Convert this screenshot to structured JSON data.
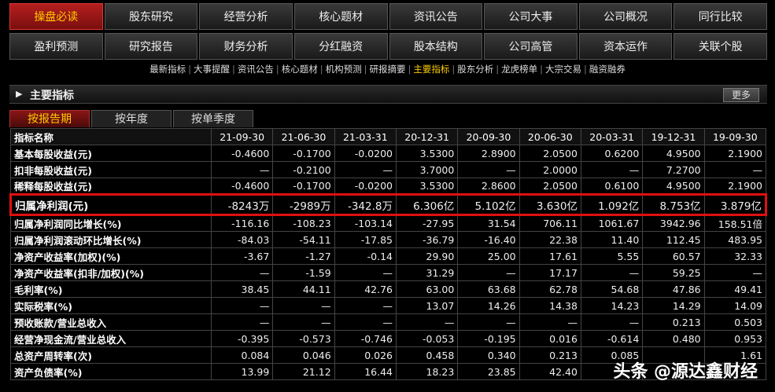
{
  "nav_rows": [
    [
      {
        "label": "操盘必读",
        "active": true
      },
      {
        "label": "股东研究",
        "active": false
      },
      {
        "label": "经营分析",
        "active": false
      },
      {
        "label": "核心题材",
        "active": false
      },
      {
        "label": "资讯公告",
        "active": false
      },
      {
        "label": "公司大事",
        "active": false
      },
      {
        "label": "公司概况",
        "active": false
      },
      {
        "label": "同行比较",
        "active": false
      }
    ],
    [
      {
        "label": "盈利预测",
        "active": false
      },
      {
        "label": "研究报告",
        "active": false
      },
      {
        "label": "财务分析",
        "active": false
      },
      {
        "label": "分红融资",
        "active": false
      },
      {
        "label": "股本结构",
        "active": false
      },
      {
        "label": "公司高管",
        "active": false
      },
      {
        "label": "资本运作",
        "active": false
      },
      {
        "label": "关联个股",
        "active": false
      }
    ]
  ],
  "subnav": [
    {
      "label": "最新指标",
      "active": false
    },
    {
      "label": "大事提醒",
      "active": false
    },
    {
      "label": "资讯公告",
      "active": false
    },
    {
      "label": "核心题材",
      "active": false
    },
    {
      "label": "机构预测",
      "active": false
    },
    {
      "label": "研报摘要",
      "active": false
    },
    {
      "label": "主要指标",
      "active": true
    },
    {
      "label": "股东分析",
      "active": false
    },
    {
      "label": "龙虎榜单",
      "active": false
    },
    {
      "label": "大宗交易",
      "active": false
    },
    {
      "label": "融资融券",
      "active": false
    }
  ],
  "section": {
    "title": "主要指标",
    "more_label": "更多"
  },
  "tabs": [
    {
      "label": "按报告期",
      "active": true
    },
    {
      "label": "按年度",
      "active": false
    },
    {
      "label": "按单季度",
      "active": false
    }
  ],
  "table": {
    "header_label": "指标名称",
    "columns": [
      "21-09-30",
      "21-06-30",
      "21-03-31",
      "20-12-31",
      "20-09-30",
      "20-06-30",
      "20-03-31",
      "19-12-31",
      "19-09-30"
    ],
    "rows": [
      {
        "name": "基本每股收益(元)",
        "values": [
          "-0.4600",
          "-0.1700",
          "-0.0200",
          "3.5300",
          "2.8900",
          "2.0500",
          "0.6200",
          "4.9500",
          "2.1900"
        ]
      },
      {
        "name": "扣非每股收益(元)",
        "values": [
          "—",
          "-0.2100",
          "—",
          "3.7000",
          "—",
          "2.0000",
          "—",
          "7.2700",
          "—"
        ]
      },
      {
        "name": "稀释每股收益(元)",
        "values": [
          "-0.4600",
          "-0.1700",
          "-0.0200",
          "3.5300",
          "2.8600",
          "2.0500",
          "0.6100",
          "4.9500",
          "2.1900"
        ]
      },
      {
        "name": "归属净利润(元)",
        "values": [
          "-8243万",
          "-2989万",
          "-342.8万",
          "6.306亿",
          "5.102亿",
          "3.630亿",
          "1.092亿",
          "8.753亿",
          "3.879亿"
        ],
        "highlight": true
      },
      {
        "name": "归属净利润同比增长(%)",
        "values": [
          "-116.16",
          "-108.23",
          "-103.14",
          "-27.95",
          "31.54",
          "706.11",
          "1061.67",
          "3942.96",
          "158.51倍"
        ]
      },
      {
        "name": "归属净利润滚动环比增长(%)",
        "values": [
          "-84.03",
          "-54.11",
          "-17.85",
          "-36.79",
          "-16.40",
          "22.38",
          "11.40",
          "112.45",
          "483.95"
        ]
      },
      {
        "name": "净资产收益率(加权)(%)",
        "values": [
          "-3.67",
          "-1.27",
          "-0.14",
          "29.90",
          "25.00",
          "17.61",
          "5.55",
          "60.57",
          "32.33"
        ]
      },
      {
        "name": "净资产收益率(扣非/加权)(%)",
        "values": [
          "—",
          "-1.59",
          "—",
          "31.29",
          "—",
          "17.17",
          "—",
          "59.25",
          "—"
        ]
      },
      {
        "name": "毛利率(%)",
        "values": [
          "38.45",
          "44.11",
          "42.76",
          "63.00",
          "63.68",
          "62.78",
          "54.68",
          "47.86",
          "49.41"
        ]
      },
      {
        "name": "实际税率(%)",
        "values": [
          "—",
          "—",
          "—",
          "13.07",
          "14.26",
          "14.38",
          "14.23",
          "14.29",
          "14.09"
        ]
      },
      {
        "name": "预收账款/营业总收入",
        "values": [
          "—",
          "—",
          "—",
          "—",
          "—",
          "—",
          "—",
          "0.213",
          "0.503"
        ]
      },
      {
        "name": "经营净现金流/营业总收入",
        "values": [
          "-0.395",
          "-0.573",
          "-0.746",
          "-0.053",
          "-0.195",
          "0.016",
          "-0.614",
          "0.480",
          "0.953"
        ]
      },
      {
        "name": "总资产周转率(次)",
        "values": [
          "0.084",
          "0.046",
          "0.026",
          "0.458",
          "0.340",
          "0.213",
          "0.085",
          "",
          "1.61"
        ]
      },
      {
        "name": "资产负债率(%)",
        "values": [
          "13.99",
          "21.12",
          "16.44",
          "18.23",
          "23.85",
          "42.40",
          "",
          "",
          ""
        ]
      }
    ]
  },
  "watermark": "头条 @源达鑫财经"
}
